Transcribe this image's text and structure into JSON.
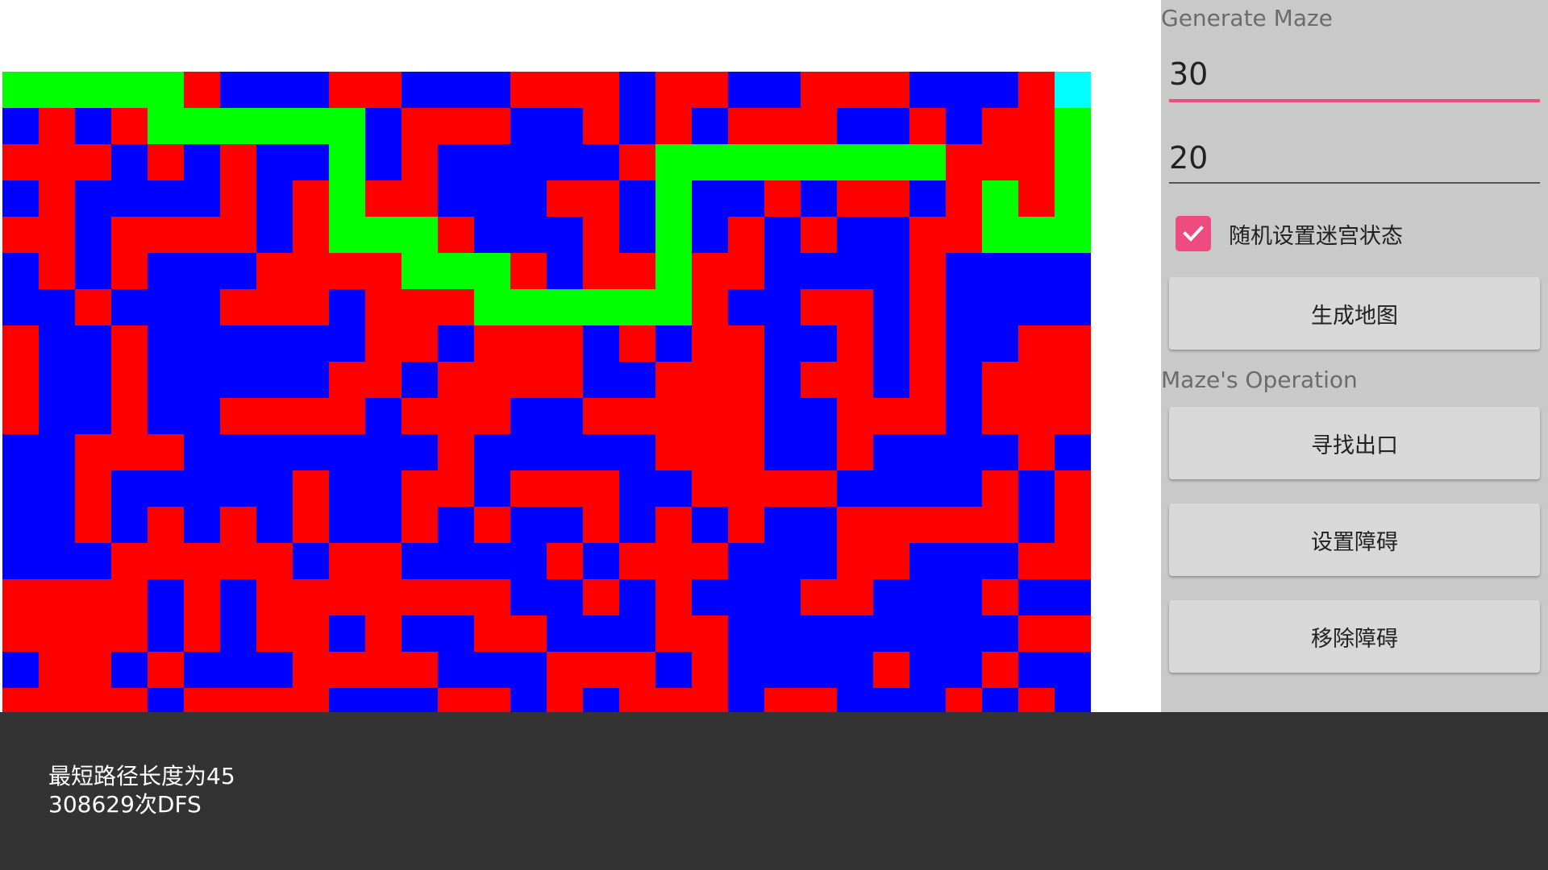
{
  "colors": {
    "wall": "#ff0000",
    "open": "#0000ff",
    "path": "#00ff00",
    "exit": "#00ffff",
    "accent": "#ee4b7e",
    "panel": "#c9c9c9",
    "bottom_bar": "#333333"
  },
  "maze": {
    "rows": 18,
    "cols": 30,
    "legend": {
      "R": "wall",
      "B": "open",
      "G": "path",
      "C": "exit"
    },
    "grid": [
      "GGGGGRBBBRRBBBRRRBRRBBRRRBBBRC",
      "BRBRGGGGGGBRRRBBRBRBRRRBBRBRRG",
      "RRRBRBRBBGBRBBBBBRGGGGGGGGRRRG",
      "BRBBBBRBRGRRBBBRRBGBBRBRRBRGRG",
      "RRBRRRRBRGGGRBBBRBGBRBRBBRRGGG",
      "BRBRBBBRRRRGGGRBRRGRRBBBBRBBBB",
      "BBRBBBRRRBRRRGGGGGGRBBRRBRBBBB",
      "RBBRBBBBBBRRBRRRBRBRRBBRBRBBRR",
      "RBBRBBBBBRRBRRRRBBRRRBRRBRBRRR",
      "RBBRBBRRRRBRRRBBRRRRRBBRRRBRRR",
      "BBRRRBBBBBBBRBBBBBRRRBBRBBBBRB",
      "BBRBBBBBRBBRRBRRRBBRRRRBBBBRBR",
      "BBRBRBRBRBBRBRBBRBRBRBBRRRRRBR",
      "BBBRRRRRBRRBBBBRBRRRBBBRRBBBRR",
      "RRRRBRBRRRRRRRBBRBRBBBRRBBBRBB",
      "RRRRBRBRRBRBBRRBBBRRBBBBBBBBRR",
      "BRRBRBBBRRRRBBBRRRBRBBBBRBBRBB",
      "RRRRBRRRRBBBRRBRBRRRBRRBBBRBRB"
    ]
  },
  "panel": {
    "generate_label": "Generate Maze",
    "rows_value": "30",
    "cols_value": "20",
    "checkbox_label": "随机设置迷宫状态",
    "checkbox_checked": true,
    "generate_button": "生成地图",
    "operation_label": "Maze's Operation",
    "find_exit_button": "寻找出口",
    "set_obstacle_button": "设置障碍",
    "remove_obstacle_button": "移除障碍"
  },
  "status": {
    "line1": "最短路径长度为45",
    "line2": "308629次DFS"
  }
}
